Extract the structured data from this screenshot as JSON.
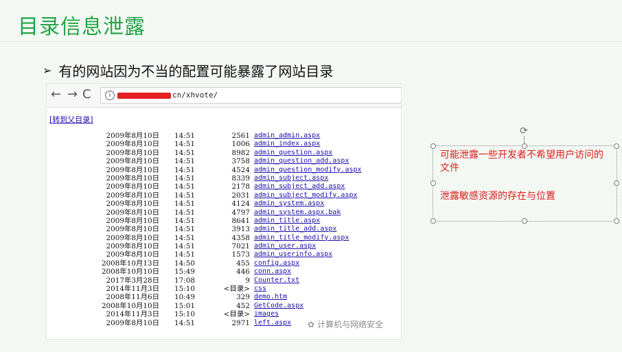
{
  "slide": {
    "title": "目录信息泄露",
    "bullet_marker": "➢",
    "bullet_text": "有的网站因为不当的配置可能暴露了网站目录",
    "title_color": "#22a447"
  },
  "browser": {
    "back_icon": "←",
    "forward_icon": "→",
    "reload_icon": "C",
    "info_icon": "i",
    "url_visible": "cn/xhvote/",
    "parent_link": "[转到父目录]",
    "entries": [
      {
        "date": "2009年8月10日",
        "time": "14:51",
        "size": "2561",
        "name": "admin_admin.aspx"
      },
      {
        "date": "2009年8月10日",
        "time": "14:51",
        "size": "1006",
        "name": "admin_index.aspx"
      },
      {
        "date": "2009年8月10日",
        "time": "14:51",
        "size": "8982",
        "name": "admin_question.aspx"
      },
      {
        "date": "2009年8月10日",
        "time": "14:51",
        "size": "3758",
        "name": "admin_question_add.aspx"
      },
      {
        "date": "2009年8月10日",
        "time": "14:51",
        "size": "4524",
        "name": "admin_question_modify.aspx"
      },
      {
        "date": "2009年8月10日",
        "time": "14:51",
        "size": "8339",
        "name": "admin_subject.aspx"
      },
      {
        "date": "2009年8月10日",
        "time": "14:51",
        "size": "2178",
        "name": "admin_subject_add.aspx"
      },
      {
        "date": "2009年8月10日",
        "time": "14:51",
        "size": "2031",
        "name": "admin_subject_modify.aspx"
      },
      {
        "date": "2009年8月10日",
        "time": "14:51",
        "size": "4124",
        "name": "admin_system.aspx"
      },
      {
        "date": "2009年8月10日",
        "time": "14:51",
        "size": "4797",
        "name": "admin_system.aspx.bak"
      },
      {
        "date": "2009年8月10日",
        "time": "14:51",
        "size": "8641",
        "name": "admin_title.aspx"
      },
      {
        "date": "2009年8月10日",
        "time": "14:51",
        "size": "3913",
        "name": "admin_title_add.aspx"
      },
      {
        "date": "2009年8月10日",
        "time": "14:51",
        "size": "4358",
        "name": "admin_title_modify.aspx"
      },
      {
        "date": "2009年8月10日",
        "time": "14:51",
        "size": "7021",
        "name": "admin_user.aspx"
      },
      {
        "date": "2009年8月10日",
        "time": "14:51",
        "size": "1573",
        "name": "admin_userinfo.aspx"
      },
      {
        "date": "2008年10月13日",
        "time": "14:50",
        "size": "455",
        "name": "config.aspx"
      },
      {
        "date": "2008年10月10日",
        "time": "15:49",
        "size": "446",
        "name": "conn.aspx"
      },
      {
        "date": "2017年3月28日",
        "time": "17:08",
        "size": "9",
        "name": "Counter.txt"
      },
      {
        "date": "2014年11月3日",
        "time": "15:10",
        "size": "<目录>",
        "name": "css"
      },
      {
        "date": "2008年11月6日",
        "time": "10:49",
        "size": "329",
        "name": "demo.htm"
      },
      {
        "date": "2008年10月10日",
        "time": "15:01",
        "size": "452",
        "name": "GetCode.aspx"
      },
      {
        "date": "2014年11月3日",
        "time": "15:10",
        "size": "<目录>",
        "name": "images"
      },
      {
        "date": "2009年8月10日",
        "time": "14:51",
        "size": "2971",
        "name": "left.aspx"
      }
    ],
    "watermark_icon": "wechat-icon",
    "watermark": "计算机与网络安全",
    "link_color": "#1a0dab",
    "redaction_color": "#e52020"
  },
  "annotation": {
    "line1": "可能泄露一些开发者不希望用户访问的文件",
    "line2": "泄露敏感资源的存在与位置",
    "rotate_icon": "⟳",
    "text_color": "#e01b1b"
  }
}
